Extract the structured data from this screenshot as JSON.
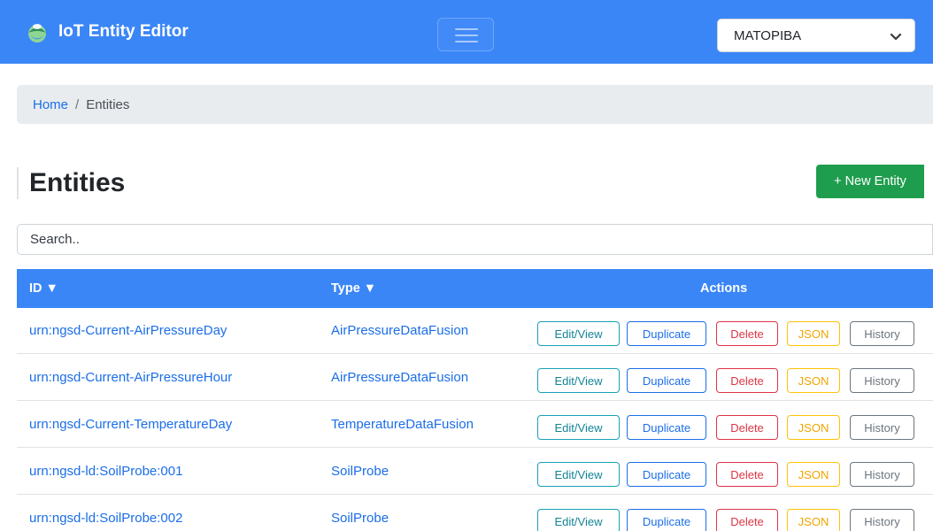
{
  "navbar": {
    "brand": "IoT Entity Editor",
    "selected_project": "MATOPIBA"
  },
  "breadcrumb": {
    "home": "Home",
    "separator": "/",
    "current": "Entities"
  },
  "page": {
    "title": "Entities",
    "new_entity_label": "+ New Entity",
    "search_placeholder": "Search.."
  },
  "table": {
    "headers": {
      "id": "ID ▼",
      "type": "Type ▼",
      "actions": "Actions"
    },
    "action_labels": {
      "edit": "Edit/View",
      "duplicate": "Duplicate",
      "delete": "Delete",
      "json": "JSON",
      "history": "History"
    },
    "rows": [
      {
        "id": "urn:ngsd-Current-AirPressureDay",
        "type": "AirPressureDataFusion"
      },
      {
        "id": "urn:ngsd-Current-AirPressureHour",
        "type": "AirPressureDataFusion"
      },
      {
        "id": "urn:ngsd-Current-TemperatureDay",
        "type": "TemperatureDataFusion"
      },
      {
        "id": "urn:ngsd-ld:SoilProbe:001",
        "type": "SoilProbe"
      },
      {
        "id": "urn:ngsd-ld:SoilProbe:002",
        "type": "SoilProbe"
      }
    ]
  },
  "colors": {
    "primary": "#3a86f7",
    "link": "#1b6ee8",
    "success": "#1f9d4e",
    "info": "#17a2b8",
    "danger": "#dc3545",
    "warning": "#ffc107",
    "secondary": "#6c757d"
  },
  "icons": {
    "logo": "leaf-drop-logo",
    "menu": "hamburger-icon",
    "dropdown": "chevron-down-icon"
  }
}
